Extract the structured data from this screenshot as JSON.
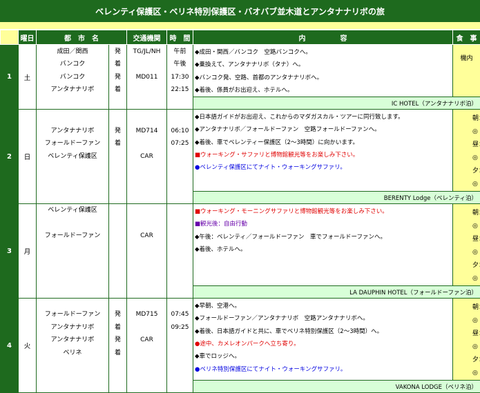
{
  "title": "ベレンティ保護区・ベリネ特別保護区・バオバブ並木道とアンタナナリボの旅",
  "header": {
    "day": "曜日",
    "city": "都　市　名",
    "transport": "交通機関",
    "time": "時　間",
    "content": "内　　　　　容",
    "meal": "食　事"
  },
  "days": [
    {
      "num": "1",
      "weekday": "土",
      "cities": [
        "成田／関西",
        "バンコク",
        "バンコク",
        "アンタナナリボ"
      ],
      "flags": [
        "発",
        "着",
        "発",
        "着"
      ],
      "transport": [
        "TG/JL/NH",
        "",
        "MD011",
        ""
      ],
      "times": [
        "午前",
        "午後",
        "17:30",
        "22:15"
      ],
      "content": [
        "◆成田・関西／バンコク　空路バンコクへ。",
        "◆乗換えて、アンタナナリボ（タナ）へ。",
        "◆バンコク発、空路、首都のアンタナナリボへ。",
        "◆着後、係員がお出迎え、ホテルへ。"
      ],
      "meal_single": "機内",
      "hotel": "IC HOTEL（アンタナナリボ泊）"
    },
    {
      "num": "2",
      "weekday": "日",
      "cities": [
        "アンタナナリボ",
        "フォールドーファン",
        "ベレンティ保護区"
      ],
      "flags": [
        "発",
        "着",
        ""
      ],
      "transport": [
        "MD714",
        "",
        "CAR"
      ],
      "times": [
        "06:10",
        "07:25",
        ""
      ],
      "content": [
        "◆日本語ガイドがお出迎え、これからのマダガスカル・ツアーに同行致します。",
        "◆アンタナナリボ／フォールドーファン　空路フォールドーファンへ。",
        "◆着後、車でベレンティー保護区（2〜3時間）に向かいます。",
        "■ウォーキング・サファリと博物館観光等をお楽しみ下さい。",
        "●ベレンティ保護区にてナイト・ウォーキングサファリ。"
      ],
      "meals": [
        "朝：◎",
        "昼：◎",
        "夕：◎"
      ],
      "hotel": "BERENTY Lodge（ベレンティ泊）"
    },
    {
      "num": "3",
      "weekday": "月",
      "cities": [
        "ベレンティ保護区",
        "フォールドーファン"
      ],
      "transport": [
        "CAR"
      ],
      "content": [
        "■ウォーキング・モーニングサファリと博物館観光等をお楽しみ下さい。",
        "■観光後：自由行動",
        "◆午後：ベレンティ／フォールドーファン　車でフォールドーファンへ。",
        "◆着後、ホテルへ。"
      ],
      "meals": [
        "朝：◎",
        "昼：◎",
        "夕：◎"
      ],
      "hotel": "LA DAUPHIN HOTEL（フォールドーファン泊）"
    },
    {
      "num": "4",
      "weekday": "火",
      "cities": [
        "フォールドーファン",
        "アンタナナリボ",
        "アンタナナリボ",
        "ベリネ"
      ],
      "flags": [
        "発",
        "着",
        "発",
        "着"
      ],
      "transport": [
        "MD715",
        "",
        "CAR",
        ""
      ],
      "times": [
        "07:45",
        "09:25",
        "",
        ""
      ],
      "content": [
        "◆早朝、空港へ。",
        "◆フォールドーファン／アンタナナリボ　空路アンタナナリボへ。",
        "◆着後、日本語ガイドと共に、車でベリネ特別保護区（2〜3時間）へ。",
        "●途中、カメレオンパークへ立ち寄り。",
        "◆車でロッジへ。",
        "●ベリネ特別保護区にてナイト・ウォーキングサファリ。"
      ],
      "meals": [
        "朝：◎",
        "昼：◎",
        "夕：◎"
      ],
      "hotel": "VAKONA LODGE（ベリネ泊）"
    }
  ]
}
